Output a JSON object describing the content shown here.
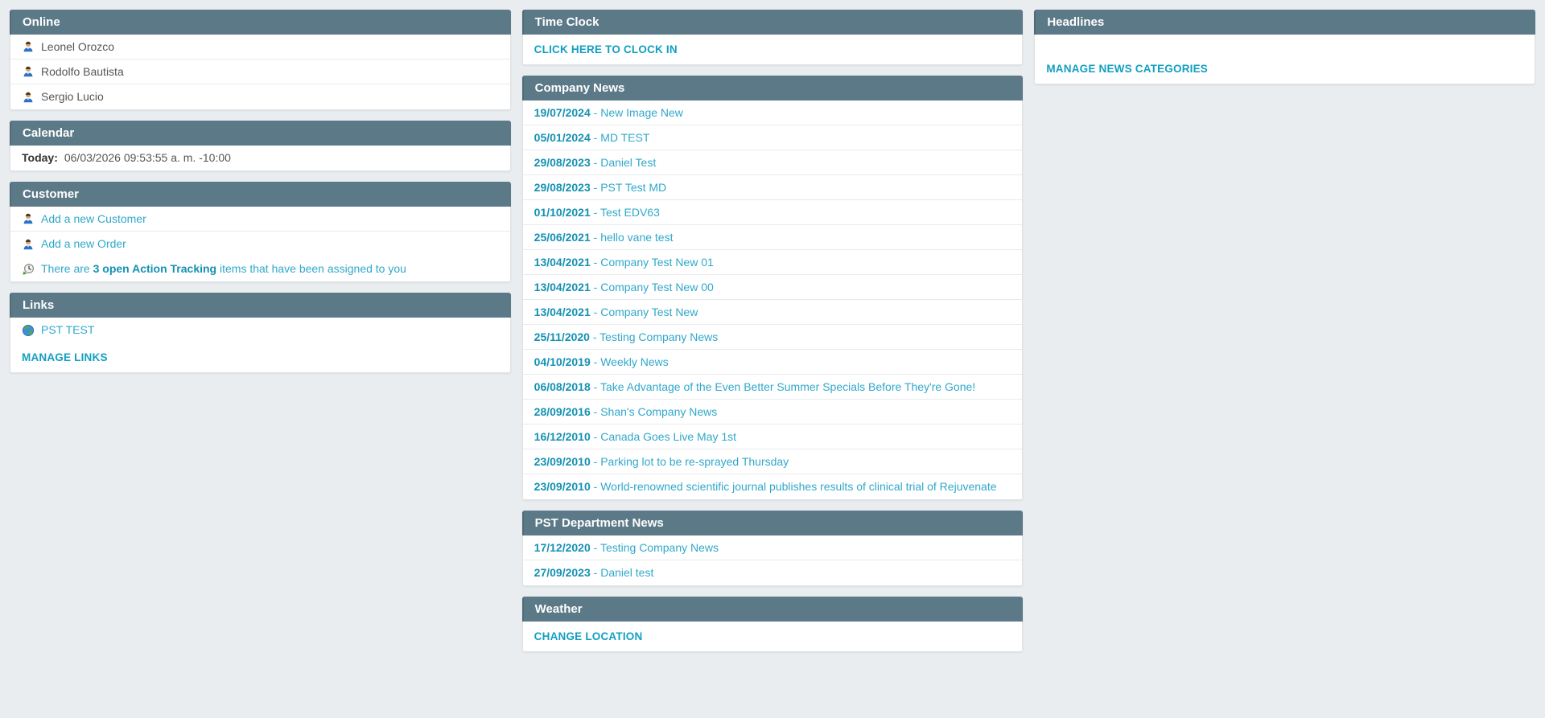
{
  "colors": {
    "page_bg": "#e9edf0",
    "panel_header_bg": "#5c7987",
    "panel_header_text": "#ffffff",
    "link": "#30a8ca",
    "link_dark": "#1591b3",
    "caps_link": "#129fc2",
    "text": "#555555",
    "text_dark": "#333333",
    "row_border": "#e8eaeb"
  },
  "left_column": {
    "online": {
      "title": "Online",
      "users": [
        {
          "name": "Leonel Orozco",
          "icon": "user-icon"
        },
        {
          "name": "Rodolfo Bautista",
          "icon": "user-icon"
        },
        {
          "name": "Sergio Lucio",
          "icon": "user-icon"
        }
      ]
    },
    "calendar": {
      "title": "Calendar",
      "today_label": "Today:",
      "today_value": "06/03/2026 09:53:55 a. m. -10:00"
    },
    "customer": {
      "title": "Customer",
      "links": [
        {
          "label": "Add a new Customer",
          "icon": "user-icon"
        },
        {
          "label": "Add a new Order",
          "icon": "user-icon"
        }
      ],
      "action_tracking": {
        "icon": "clock-arrow-icon",
        "text_pre": "There are ",
        "text_bold": "3 open Action Tracking",
        "text_post": " items that have been assigned to you"
      }
    },
    "links": {
      "title": "Links",
      "items": [
        {
          "label": "PST TEST",
          "icon": "globe-icon"
        }
      ],
      "manage_label": "MANAGE LINKS"
    }
  },
  "middle_column": {
    "time_clock": {
      "title": "Time Clock",
      "clock_in_label": "CLICK HERE TO CLOCK IN"
    },
    "company_news": {
      "title": "Company News",
      "separator": " - ",
      "items": [
        {
          "date": "19/07/2024",
          "title": "New Image New"
        },
        {
          "date": "05/01/2024",
          "title": "MD TEST"
        },
        {
          "date": "29/08/2023",
          "title": "Daniel Test"
        },
        {
          "date": "29/08/2023",
          "title": "PST Test MD"
        },
        {
          "date": "01/10/2021",
          "title": "Test EDV63"
        },
        {
          "date": "25/06/2021",
          "title": "hello vane test"
        },
        {
          "date": "13/04/2021",
          "title": "Company Test New 01"
        },
        {
          "date": "13/04/2021",
          "title": "Company Test New 00"
        },
        {
          "date": "13/04/2021",
          "title": "Company Test New"
        },
        {
          "date": "25/11/2020",
          "title": "Testing Company News"
        },
        {
          "date": "04/10/2019",
          "title": "Weekly News"
        },
        {
          "date": "06/08/2018",
          "title": "Take Advantage of the Even Better Summer Specials Before They're Gone!"
        },
        {
          "date": "28/09/2016",
          "title": "Shan's Company News"
        },
        {
          "date": "16/12/2010",
          "title": "Canada Goes Live May 1st"
        },
        {
          "date": "23/09/2010",
          "title": "Parking lot to be re-sprayed Thursday"
        },
        {
          "date": "23/09/2010",
          "title": "World-renowned scientific journal publishes results of clinical trial of Rejuvenate"
        }
      ]
    },
    "pst_department_news": {
      "title": "PST Department News",
      "separator": " - ",
      "items": [
        {
          "date": "17/12/2020",
          "title": "Testing Company News"
        },
        {
          "date": "27/09/2023",
          "title": "Daniel test"
        }
      ]
    },
    "weather": {
      "title": "Weather",
      "change_location_label": "CHANGE LOCATION"
    }
  },
  "right_column": {
    "headlines": {
      "title": "Headlines",
      "manage_label": "MANAGE NEWS CATEGORIES"
    }
  }
}
